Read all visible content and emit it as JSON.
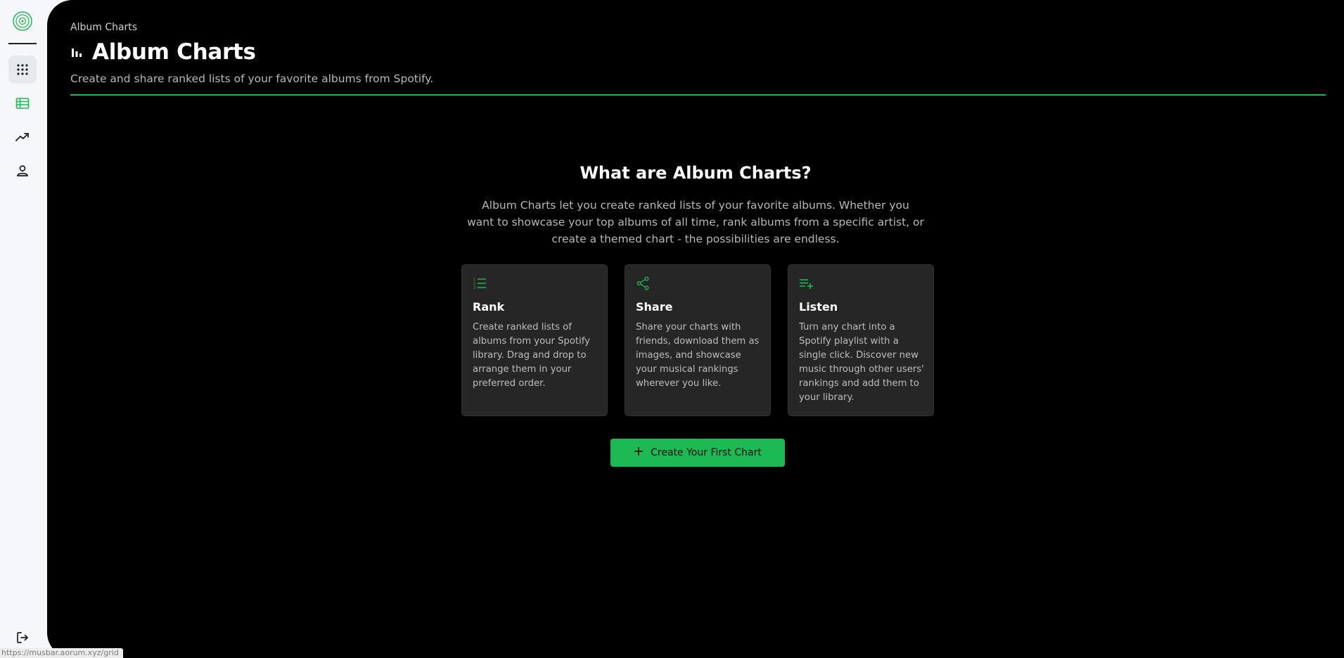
{
  "app": {
    "title": "Album Charts"
  },
  "rail": {
    "logo_icon": "vinyl-disc-icon",
    "items": [
      {
        "name": "grid",
        "icon": "grid-dots-icon",
        "active": true
      },
      {
        "name": "charts",
        "icon": "table-icon",
        "active": false
      },
      {
        "name": "trends",
        "icon": "trending-up-icon",
        "active": false
      },
      {
        "name": "profile",
        "icon": "user-icon",
        "active": false
      }
    ],
    "logout_icon": "logout-icon"
  },
  "header": {
    "breadcrumb": "Album Charts",
    "title": "Album Charts",
    "subtitle": "Create and share ranked lists of your favorite albums from Spotify."
  },
  "intro": {
    "heading": "What are Album Charts?",
    "description": "Album Charts let you create ranked lists of your favorite albums. Whether you want to showcase your top albums of all time, rank albums from a specific artist, or create a themed chart - the possibilities are endless."
  },
  "features": [
    {
      "icon": "ranked-list-icon",
      "title": "Rank",
      "text": "Create ranked lists of albums from your Spotify library. Drag and drop to arrange them in your preferred order."
    },
    {
      "icon": "share-icon",
      "title": "Share",
      "text": "Share your charts with friends, download them as images, and showcase your musical rankings wherever you like."
    },
    {
      "icon": "playlist-add-icon",
      "title": "Listen",
      "text": "Turn any chart into a Spotify playlist with a single click. Discover new music through other users' rankings and add them to your library."
    }
  ],
  "cta": {
    "label": "Create Your First Chart"
  },
  "status_bar": {
    "url": "https://musbar.aorum.xyz/grid"
  },
  "colors": {
    "accent": "#1db954",
    "background": "#000000",
    "card": "#262626",
    "rail": "#f5f7fa"
  }
}
